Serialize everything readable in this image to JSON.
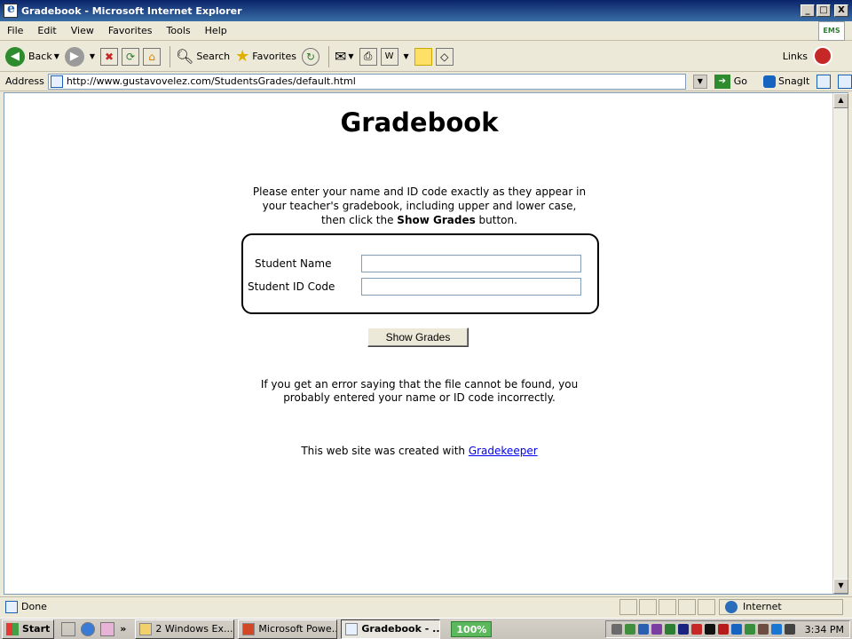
{
  "window": {
    "title": "Gradebook - Microsoft Internet Explorer",
    "minimize_glyph": "_",
    "maximize_glyph": "□",
    "close_glyph": "X"
  },
  "menu": [
    "File",
    "Edit",
    "View",
    "Favorites",
    "Tools",
    "Help"
  ],
  "logo_text": "EMS",
  "toolbar": {
    "back": "Back",
    "search": "Search",
    "favorites": "Favorites",
    "links": "Links"
  },
  "address": {
    "label": "Address",
    "url": "http://www.gustavovelez.com/StudentsGrades/default.html",
    "go": "Go",
    "snagit": "SnagIt"
  },
  "page": {
    "title": "Gradebook",
    "instructions_line1": "Please enter your name and ID code exactly as they appear in",
    "instructions_line2": "your teacher's gradebook, including upper and lower case,",
    "instructions_line3_pre": "then click the ",
    "instructions_line3_bold": "Show Grades",
    "instructions_line3_post": " button.",
    "student_name_label": "Student Name",
    "student_name_value": "",
    "student_id_label": "Student ID Code",
    "student_id_value": "",
    "show_grades_button": "Show Grades",
    "error_line1": "If you get an error saying that the file cannot be found, you",
    "error_line2": "probably entered your name or ID code incorrectly.",
    "footer_pre": "This web site was created with ",
    "footer_link": "Gradekeeper"
  },
  "statusbar": {
    "status": "Done",
    "zone": "Internet"
  },
  "taskbar": {
    "start": "Start",
    "chevron": "»",
    "tasks": [
      "2 Windows Ex...",
      "Microsoft Powe...",
      "Gradebook - ..."
    ],
    "zoom": "100%",
    "clock": "3:34 PM"
  }
}
